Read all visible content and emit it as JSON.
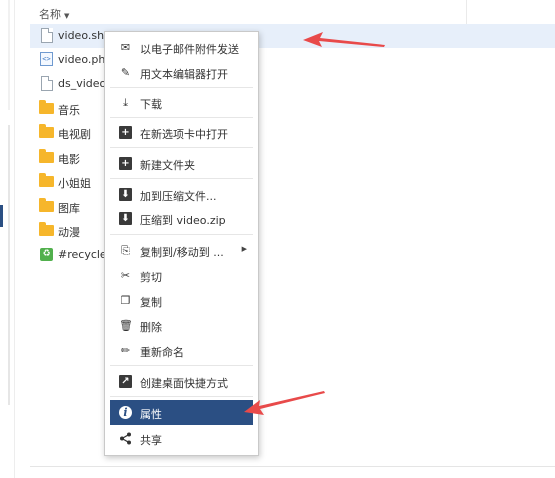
{
  "header": {
    "name_column": "名称",
    "sort_glyph": "▼"
  },
  "files": [
    {
      "name": "video.sh",
      "type": "file",
      "selected": true
    },
    {
      "name": "video.ph",
      "type": "php",
      "selected": false
    },
    {
      "name": "ds_video",
      "type": "file",
      "selected": false
    },
    {
      "name": "音乐",
      "type": "folder",
      "selected": false
    },
    {
      "name": "电视剧",
      "type": "folder",
      "selected": false
    },
    {
      "name": "电影",
      "type": "folder",
      "selected": false
    },
    {
      "name": "小姐姐",
      "type": "folder",
      "selected": false
    },
    {
      "name": "图库",
      "type": "folder",
      "selected": false
    },
    {
      "name": "动漫",
      "type": "folder",
      "selected": false
    },
    {
      "name": "#recycle",
      "type": "recycle",
      "selected": false
    }
  ],
  "php_icon_glyph": "<>",
  "recycle_icon_glyph": "♻",
  "context_menu": {
    "items": [
      {
        "label": "以电子邮件附件发送",
        "icon": "mail-icon",
        "glyph": "✉"
      },
      {
        "label": "用文本编辑器打开",
        "icon": "edit-icon",
        "glyph": "✎"
      },
      {
        "label": "下载",
        "icon": "download-icon",
        "glyph": "⤓"
      },
      {
        "label": "在新选项卡中打开",
        "icon": "new-tab-icon",
        "glyph": "+"
      },
      {
        "label": "新建文件夹",
        "icon": "new-folder-icon",
        "glyph": "+"
      },
      {
        "label": "加到压缩文件...",
        "icon": "compress-icon",
        "glyph": "⬇"
      },
      {
        "label": "压缩到 video.zip",
        "icon": "compress-zip-icon",
        "glyph": "⬇"
      },
      {
        "label": "复制到/移动到 ...",
        "icon": "copy-move-icon",
        "glyph": "⎘",
        "submenu_glyph": "▶"
      },
      {
        "label": "剪切",
        "icon": "scissors-icon",
        "glyph": "✂"
      },
      {
        "label": "复制",
        "icon": "copy-icon",
        "glyph": "❐"
      },
      {
        "label": "删除",
        "icon": "trash-icon",
        "glyph": "🗑"
      },
      {
        "label": "重新命名",
        "icon": "pencil-icon",
        "glyph": "✏"
      },
      {
        "label": "创建桌面快捷方式",
        "icon": "shortcut-icon",
        "glyph": "↗"
      },
      {
        "label": "属性",
        "icon": "info-icon",
        "glyph": "i",
        "active": true
      },
      {
        "label": "共享",
        "icon": "share-icon",
        "glyph": "⋖"
      }
    ]
  },
  "colors": {
    "accent": "#2b4f83",
    "selection": "#e7effa",
    "arrow": "#e84a4a",
    "folder": "#f6b62b"
  }
}
